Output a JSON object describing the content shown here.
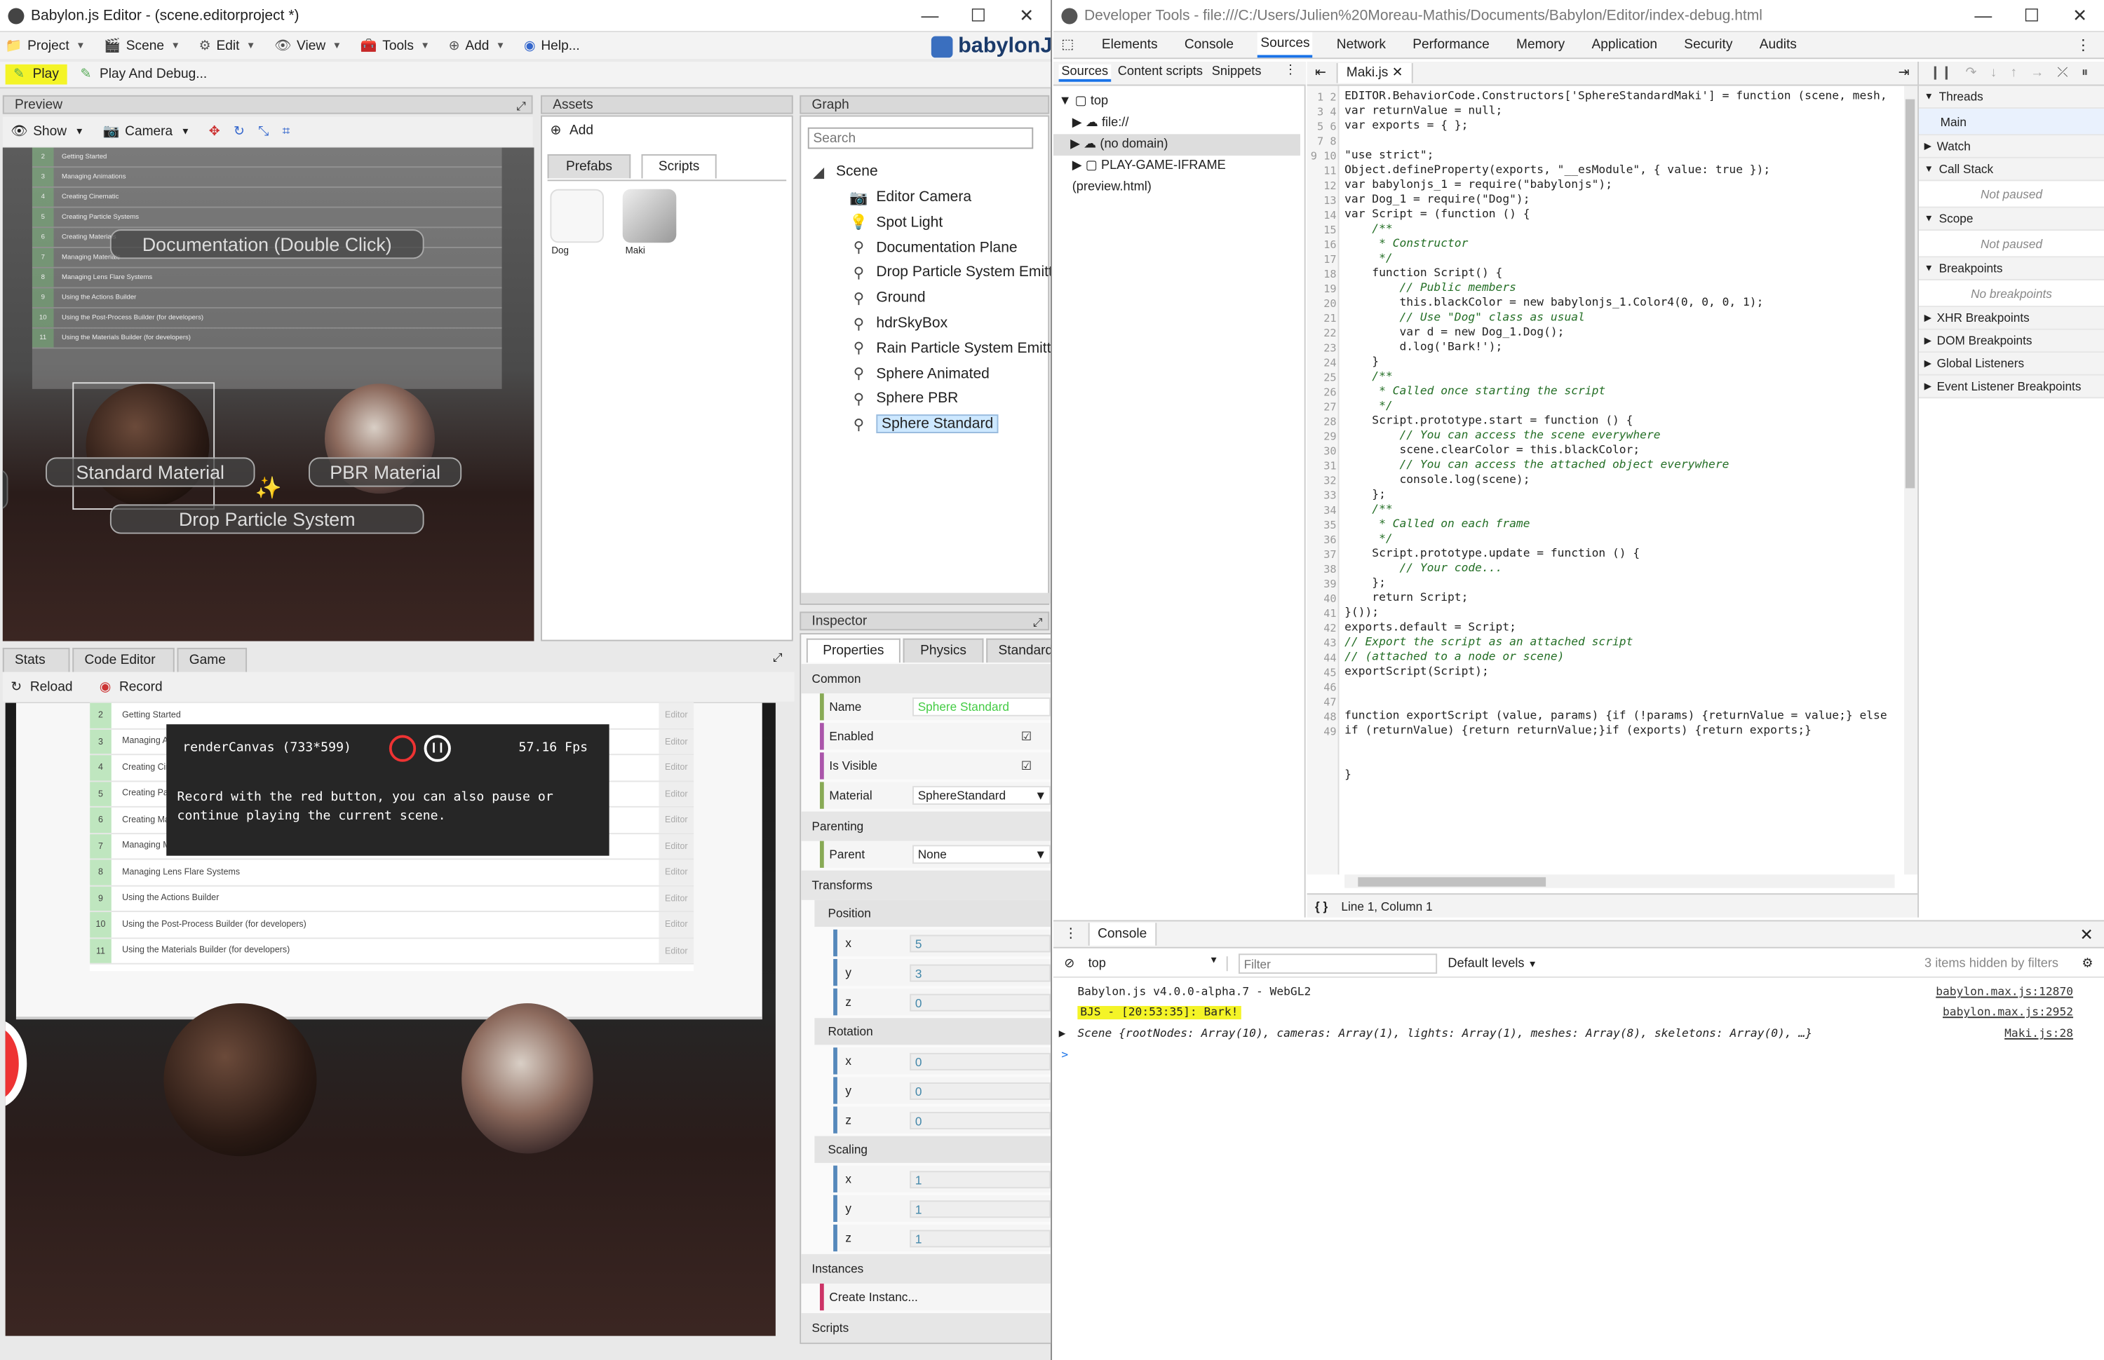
{
  "editor": {
    "title": "Babylon.js Editor - (scene.editorproject *)",
    "menu": [
      {
        "label": "Project",
        "icon": "folder-icon"
      },
      {
        "label": "Scene",
        "icon": "scene-icon"
      },
      {
        "label": "Edit",
        "icon": "gear-icon"
      },
      {
        "label": "View",
        "icon": "eye-icon"
      },
      {
        "label": "Tools",
        "icon": "tools-icon"
      },
      {
        "label": "Add",
        "icon": "plus-icon"
      },
      {
        "label": "Help...",
        "icon": "help-icon"
      }
    ],
    "brand": "babylonJS",
    "play_label": "Play",
    "play_debug_label": "Play And Debug...",
    "preview": {
      "header": "Preview",
      "show_label": "Show",
      "camera_label": "Camera",
      "doc_rows": [
        "Getting Started",
        "Managing Animations",
        "Creating Cinematic",
        "Creating Particle Systems",
        "Creating Materials",
        "Managing Materials",
        "Managing Lens Flare Systems",
        "Using the Actions Builder",
        "Using the Post-Process Builder (for developers)",
        "Using the Materials Builder (for developers)"
      ],
      "doc_row_numbers": [
        "2",
        "3",
        "4",
        "5",
        "6",
        "7",
        "8",
        "9",
        "10",
        "11"
      ],
      "doc_label": "Documentation (Double Click)",
      "standard_label": "Standard Material",
      "pbr_label": "PBR Material",
      "particle_label": "Drop Particle System"
    },
    "assets": {
      "header": "Assets",
      "add_label": "Add",
      "tabs": [
        "Prefabs",
        "Scripts"
      ],
      "items": [
        "Dog",
        "Maki"
      ]
    },
    "graph": {
      "header": "Graph",
      "search_placeholder": "Search",
      "root": "Scene",
      "nodes": [
        "Editor Camera",
        "Spot Light",
        "Documentation Plane",
        "Drop Particle System Emitter",
        "Ground",
        "hdrSkyBox",
        "Rain Particle System Emitter",
        "Sphere Animated",
        "Sphere PBR",
        "Sphere Standard"
      ]
    },
    "bottom_tabs": [
      "Stats",
      "Code Editor",
      "Game"
    ],
    "reload_label": "Reload",
    "record_label": "Record",
    "game": {
      "canvas_label": "renderCanvas (733*599)",
      "fps": "57.16 Fps",
      "tooltip": "Record with the red button, you can also pause or continue playing the current scene.",
      "rows": [
        "Getting Started",
        "Managing Animations",
        "Creating Cinematic",
        "Creating Particle Systems",
        "Creating Materials",
        "Managing Materials",
        "Managing Lens Flare Systems",
        "Using the Actions Builder",
        "Using the Post-Process Builder (for developers)",
        "Using the Materials Builder (for developers)"
      ],
      "row_numbers": [
        "2",
        "3",
        "4",
        "5",
        "6",
        "7",
        "8",
        "9",
        "10",
        "11"
      ],
      "row_tag": "Editor"
    },
    "inspector": {
      "header": "Inspector",
      "tabs": [
        "Properties",
        "Physics",
        "Standard"
      ],
      "common": "Common",
      "name_label": "Name",
      "name_value": "Sphere Standard",
      "enabled_label": "Enabled",
      "visible_label": "Is Visible",
      "material_label": "Material",
      "material_value": "SphereStandard",
      "parenting": "Parenting",
      "parent_label": "Parent",
      "parent_value": "None",
      "transforms": "Transforms",
      "position": "Position",
      "position_values": {
        "x": "5",
        "y": "3",
        "z": "0"
      },
      "rotation": "Rotation",
      "rotation_values": {
        "x": "0",
        "y": "0",
        "z": "0"
      },
      "scaling": "Scaling",
      "scaling_values": {
        "x": "1",
        "y": "1",
        "z": "1"
      },
      "instances": "Instances",
      "create_instance": "Create Instanc...",
      "scripts": "Scripts"
    }
  },
  "devtools": {
    "title": "Developer Tools - file:///C:/Users/Julien%20Moreau-Mathis/Documents/Babylon/Editor/index-debug.html",
    "tabs": [
      "Elements",
      "Console",
      "Sources",
      "Network",
      "Performance",
      "Memory",
      "Application",
      "Security",
      "Audits"
    ],
    "active_tab": "Sources",
    "nav_tabs": [
      "Sources",
      "Content scripts",
      "Snippets"
    ],
    "tree": [
      "top",
      "file://",
      "(no domain)",
      "PLAY-GAME-IFRAME (preview.html)"
    ],
    "file_tab": "Maki.js",
    "cursor_status": "Line 1, Column 1",
    "right_sections": [
      {
        "title": "Threads",
        "body": "Main"
      },
      {
        "title": "Watch"
      },
      {
        "title": "Call Stack",
        "body": "Not paused"
      },
      {
        "title": "Scope",
        "body": "Not paused"
      },
      {
        "title": "Breakpoints",
        "body": "No breakpoints"
      },
      {
        "title": "XHR Breakpoints"
      },
      {
        "title": "DOM Breakpoints"
      },
      {
        "title": "Global Listeners"
      },
      {
        "title": "Event Listener Breakpoints"
      }
    ],
    "console": {
      "tab": "Console",
      "context": "top",
      "filter_placeholder": "Filter",
      "levels": "Default levels",
      "hidden": "3 items hidden by filters",
      "lines": [
        {
          "text": "Babylon.js v4.0.0-alpha.7 - WebGL2",
          "src": "babylon.max.js:12870"
        },
        {
          "text": "BJS - [20:53:35]: Bark!",
          "src": "babylon.max.js:2952"
        },
        {
          "text": "Scene {rootNodes: Array(10), cameras: Array(1), lights: Array(1), meshes: Array(8), skeletons: Array(0), …}",
          "src": "Maki.js:28"
        }
      ],
      "prompt": ">"
    },
    "code_lines": [
      "EDITOR.BehaviorCode.Constructors['SphereStandardMaki'] = function (scene, mesh, ",
      "var returnValue = null;",
      "var exports = { };",
      "",
      "\"use strict\";",
      "Object.defineProperty(exports, \"__esModule\", { value: true });",
      "var babylonjs_1 = require(\"babylonjs\");",
      "var Dog_1 = require(\"Dog\");",
      "var Script = (function () {",
      "    /**",
      "     * Constructor",
      "     */",
      "    function Script() {",
      "        // Public members",
      "        this.blackColor = new babylonjs_1.Color4(0, 0, 0, 1);",
      "        // Use \"Dog\" class as usual",
      "        var d = new Dog_1.Dog();",
      "        d.log('Bark!');",
      "    }",
      "    /**",
      "     * Called once starting the script",
      "     */",
      "    Script.prototype.start = function () {",
      "        // You can access the scene everywhere",
      "        scene.clearColor = this.blackColor;",
      "        // You can access the attached object everywhere",
      "        console.log(scene);",
      "    };",
      "    /**",
      "     * Called on each frame",
      "     */",
      "    Script.prototype.update = function () {",
      "        // Your code...",
      "    };",
      "    return Script;",
      "}());",
      "exports.default = Script;",
      "// Export the script as an attached script",
      "// (attached to a node or scene)",
      "exportScript(Script);",
      "",
      "",
      "function exportScript (value, params) {if (!params) {returnValue = value;} else",
      "if (returnValue) {return returnValue;}if (exports) {return exports;}",
      "",
      "",
      "}",
      "",
      ""
    ]
  },
  "colors": {
    "highlight": "#f4f427",
    "selection": "#cde8ff",
    "accent": "#1a73e8"
  }
}
